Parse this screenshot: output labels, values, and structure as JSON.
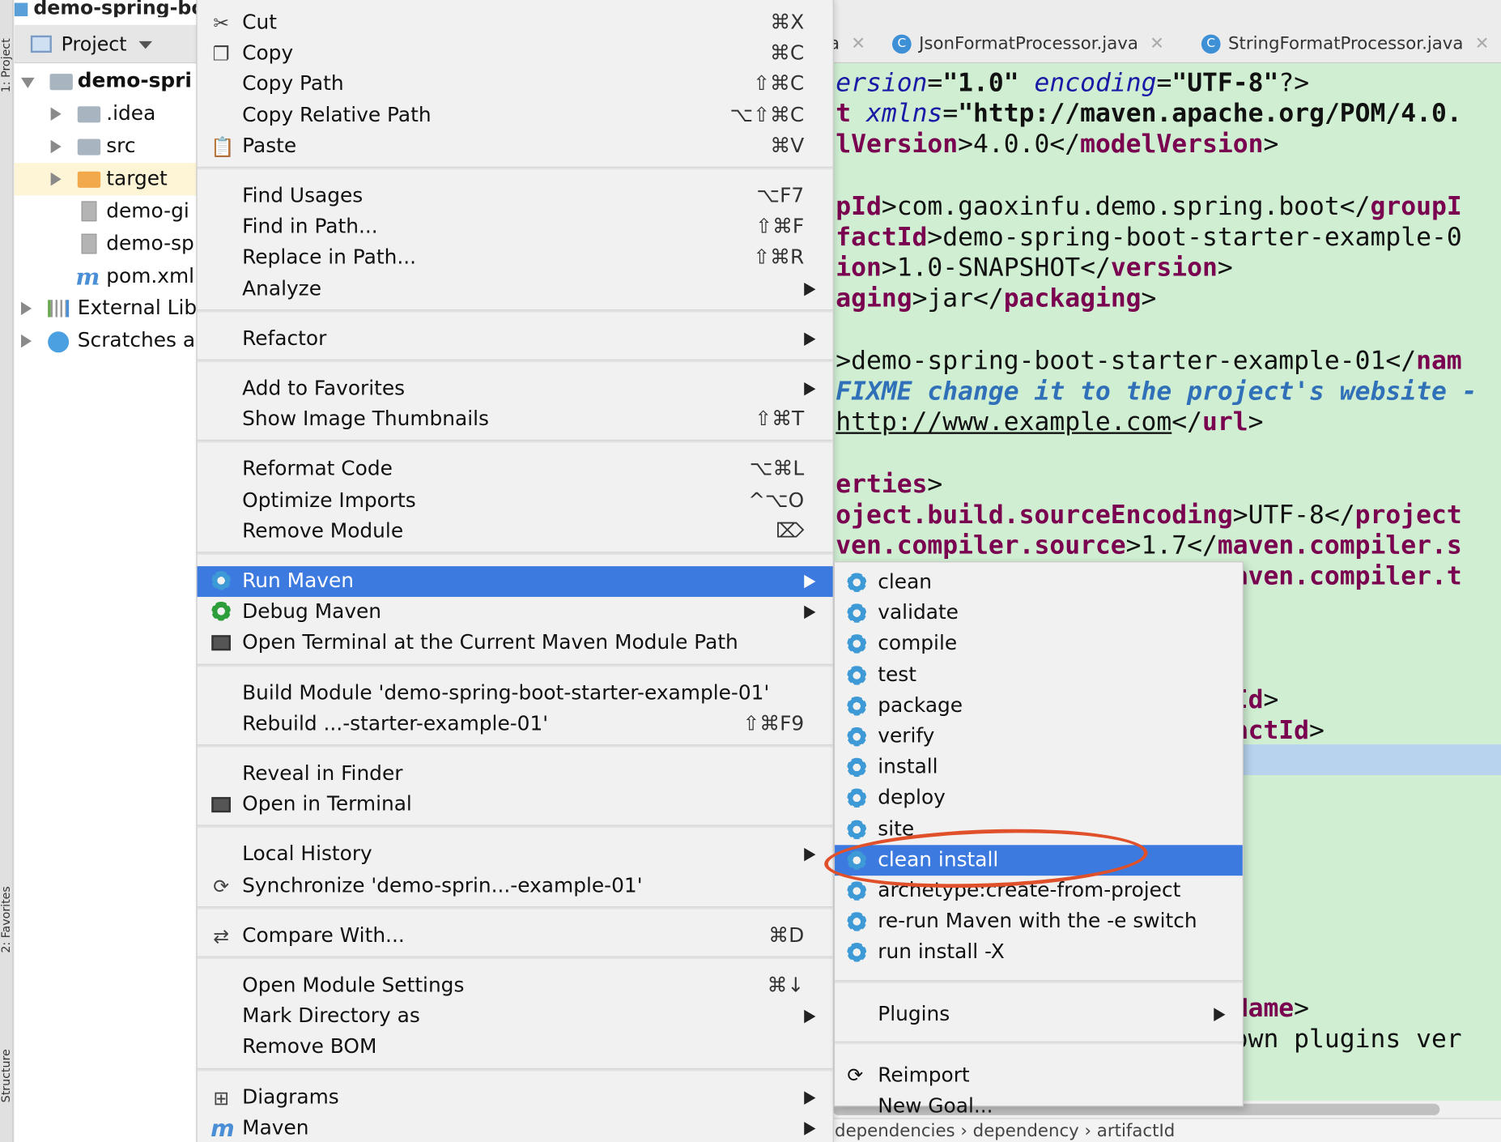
{
  "window_title": "demo-spring-bo",
  "tool_strip": {
    "project_tab": "1: Project",
    "favorites_tab": "2: Favorites",
    "structure_tab": "Structure"
  },
  "project_panel": {
    "view_label": "Project",
    "tree": [
      {
        "label": "demo-spri",
        "kind": "module",
        "expanded": true
      },
      {
        "label": ".idea",
        "kind": "folder"
      },
      {
        "label": "src",
        "kind": "folder"
      },
      {
        "label": "target",
        "kind": "folder-excluded"
      },
      {
        "label": "demo-gi",
        "kind": "file"
      },
      {
        "label": "demo-sp",
        "kind": "file"
      },
      {
        "label": "pom.xml",
        "kind": "maven-file"
      },
      {
        "label": "External Lib",
        "kind": "library"
      },
      {
        "label": "Scratches ar",
        "kind": "scratches"
      }
    ]
  },
  "editor": {
    "tabs": [
      {
        "label": "a",
        "icon": "class-icon"
      },
      {
        "label": "JsonFormatProcessor.java",
        "icon": "class-icon"
      },
      {
        "label": "StringFormatProcessor.java",
        "icon": "class-icon"
      }
    ],
    "lines": [
      {
        "parts": [
          [
            "at",
            "ersion"
          ],
          [
            "txt",
            "="
          ],
          [
            "str",
            "\"1.0\""
          ],
          [
            "txt",
            " "
          ],
          [
            "at",
            "encoding"
          ],
          [
            "txt",
            "="
          ],
          [
            "str",
            "\"UTF-8\""
          ],
          [
            "txt",
            "?>"
          ]
        ]
      },
      {
        "parts": [
          [
            "tg",
            "t "
          ],
          [
            "at",
            "xmlns"
          ],
          [
            "txt",
            "="
          ],
          [
            "str",
            "\"http://maven.apache.org/POM/4.0."
          ]
        ]
      },
      {
        "parts": [
          [
            "tg",
            "lVersion"
          ],
          [
            "txt",
            ">4.0.0</"
          ],
          [
            "tg",
            "modelVersion"
          ],
          [
            "txt",
            ">"
          ]
        ]
      },
      {
        "parts": []
      },
      {
        "parts": [
          [
            "tg",
            "pId"
          ],
          [
            "txt",
            ">com.gaoxinfu.demo.spring.boot</"
          ],
          [
            "tg",
            "groupI"
          ]
        ]
      },
      {
        "parts": [
          [
            "tg",
            "factId"
          ],
          [
            "txt",
            ">demo-spring-boot-starter-example-0"
          ]
        ]
      },
      {
        "parts": [
          [
            "tg",
            "ion"
          ],
          [
            "txt",
            ">1.0-SNAPSHOT</"
          ],
          [
            "tg",
            "version"
          ],
          [
            "txt",
            ">"
          ]
        ]
      },
      {
        "parts": [
          [
            "tg",
            "aging"
          ],
          [
            "txt",
            ">jar</"
          ],
          [
            "tg",
            "packaging"
          ],
          [
            "txt",
            ">"
          ]
        ]
      },
      {
        "parts": []
      },
      {
        "parts": [
          [
            "txt",
            ">demo-spring-boot-starter-example-01</"
          ],
          [
            "tg",
            "nam"
          ]
        ]
      },
      {
        "parts": [
          [
            "cm",
            "FIXME change it to the project's website -"
          ]
        ]
      },
      {
        "parts": [
          [
            "ul",
            "http://www.example.com"
          ],
          [
            "txt",
            "</"
          ],
          [
            "tg",
            "url"
          ],
          [
            "txt",
            ">"
          ]
        ]
      },
      {
        "parts": []
      },
      {
        "parts": [
          [
            "tg",
            "erties"
          ],
          [
            "txt",
            ">"
          ]
        ]
      },
      {
        "parts": [
          [
            "tg",
            "oject.build.sourceEncoding"
          ],
          [
            "txt",
            ">UTF-8</"
          ],
          [
            "tg",
            "project"
          ]
        ]
      },
      {
        "parts": [
          [
            "tg",
            "ven.compiler.source"
          ],
          [
            "txt",
            ">1.7</"
          ],
          [
            "tg",
            "maven.compiler.s"
          ]
        ]
      },
      {
        "parts": [
          [
            "txt",
            "                         "
          ],
          [
            "tg",
            "maven.compiler.t"
          ]
        ]
      },
      {
        "parts": []
      },
      {
        "parts": []
      },
      {
        "parts": []
      },
      {
        "parts": [
          [
            "txt",
            "                         "
          ],
          [
            "tg",
            "pId"
          ],
          [
            "txt",
            ">"
          ]
        ]
      },
      {
        "parts": [
          [
            "txt",
            "                         "
          ],
          [
            "tg",
            "factId"
          ],
          [
            "txt",
            ">"
          ]
        ]
      },
      {
        "parts": []
      },
      {
        "parts": []
      },
      {
        "parts": []
      },
      {
        "parts": []
      },
      {
        "parts": []
      },
      {
        "parts": []
      },
      {
        "parts": []
      },
      {
        "parts": []
      },
      {
        "parts": [
          [
            "txt",
            "                         "
          ],
          [
            "tg",
            "lName"
          ],
          [
            "txt",
            ">"
          ]
        ]
      },
      {
        "parts": [
          [
            "txt",
            "                         down plugins ver"
          ]
        ]
      }
    ],
    "breadcrumb": "dependencies  ›  dependency  ›  artifactId"
  },
  "context_menu": {
    "groups": [
      [
        {
          "label": "Cut",
          "shortcut": "⌘X",
          "icon": "cut-icon"
        },
        {
          "label": "Copy",
          "shortcut": "⌘C",
          "icon": "copy-icon"
        },
        {
          "label": "Copy Path",
          "shortcut": "⇧⌘C"
        },
        {
          "label": "Copy Relative Path",
          "shortcut": "⌥⇧⌘C"
        },
        {
          "label": "Paste",
          "shortcut": "⌘V",
          "icon": "paste-icon"
        }
      ],
      [
        {
          "label": "Find Usages",
          "shortcut": "⌥F7"
        },
        {
          "label": "Find in Path...",
          "shortcut": "⇧⌘F"
        },
        {
          "label": "Replace in Path...",
          "shortcut": "⇧⌘R"
        },
        {
          "label": "Analyze",
          "submenu": true
        }
      ],
      [
        {
          "label": "Refactor",
          "submenu": true
        }
      ],
      [
        {
          "label": "Add to Favorites",
          "submenu": true
        },
        {
          "label": "Show Image Thumbnails",
          "shortcut": "⇧⌘T"
        }
      ],
      [
        {
          "label": "Reformat Code",
          "shortcut": "⌥⌘L"
        },
        {
          "label": "Optimize Imports",
          "shortcut": "^⌥O"
        },
        {
          "label": "Remove Module",
          "shortcut": "⌦"
        }
      ],
      [
        {
          "label": "Run Maven",
          "submenu": true,
          "icon": "maven-run-icon",
          "highlighted": true
        },
        {
          "label": "Debug Maven",
          "submenu": true,
          "icon": "maven-debug-icon"
        },
        {
          "label": "Open Terminal at the Current Maven Module Path",
          "icon": "terminal-icon"
        }
      ],
      [
        {
          "label": "Build Module 'demo-spring-boot-starter-example-01'"
        },
        {
          "label": "Rebuild ...-starter-example-01'",
          "shortcut": "⇧⌘F9"
        }
      ],
      [
        {
          "label": "Reveal in Finder"
        },
        {
          "label": "Open in Terminal",
          "icon": "terminal-icon"
        }
      ],
      [
        {
          "label": "Local History",
          "submenu": true
        },
        {
          "label": "Synchronize 'demo-sprin...-example-01'",
          "icon": "sync-icon"
        }
      ],
      [
        {
          "label": "Compare With...",
          "shortcut": "⌘D",
          "icon": "compare-icon"
        }
      ],
      [
        {
          "label": "Open Module Settings",
          "shortcut": "⌘↓"
        },
        {
          "label": "Mark Directory as",
          "submenu": true
        },
        {
          "label": "Remove BOM"
        }
      ],
      [
        {
          "label": "Diagrams",
          "submenu": true,
          "icon": "diagram-icon"
        },
        {
          "label": "Maven",
          "submenu": true,
          "icon": "maven-icon"
        }
      ]
    ]
  },
  "maven_submenu": {
    "goals": [
      "clean",
      "validate",
      "compile",
      "test",
      "package",
      "verify",
      "install",
      "deploy",
      "site",
      "clean install",
      "archetype:create-from-project",
      "re-run Maven with the -e switch",
      "run install -X"
    ],
    "highlighted_goal": "clean install",
    "plugins_label": "Plugins",
    "reimport_label": "Reimport",
    "new_goal_label": "New Goal..."
  },
  "colors": {
    "highlight": "#3d7ae0",
    "editor_bg": "#cfeed2",
    "annotation": "#e0502a",
    "xml_tag": "#7a0050"
  }
}
